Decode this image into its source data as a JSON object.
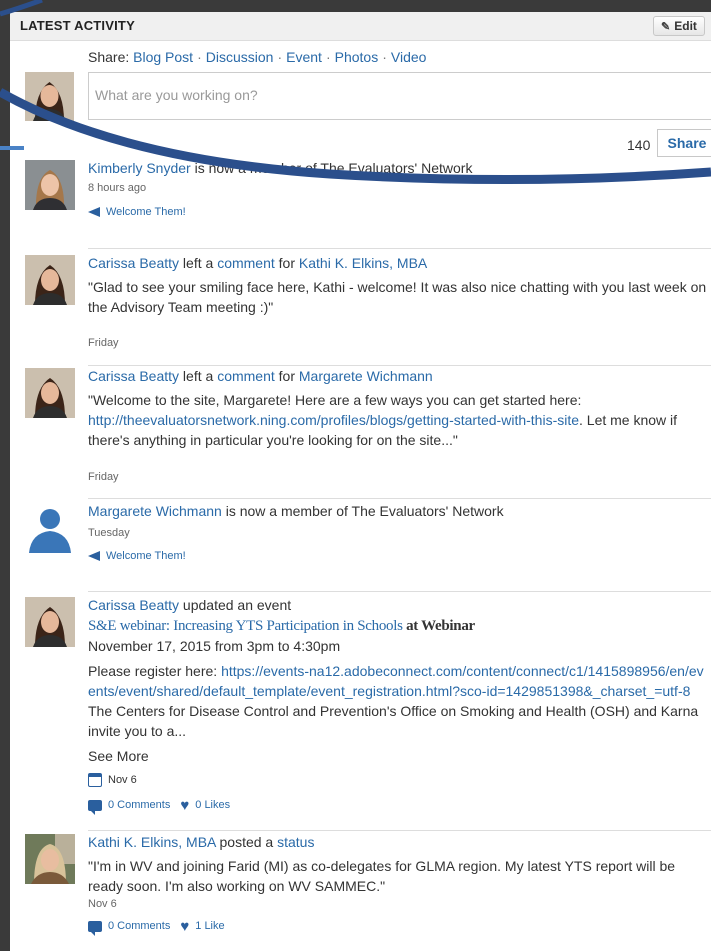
{
  "header": {
    "title": "LATEST ACTIVITY",
    "edit_label": "Edit"
  },
  "share": {
    "label": "Share:",
    "options": [
      "Blog Post",
      "Discussion",
      "Event",
      "Photos",
      "Video"
    ],
    "placeholder": "What are you working on?",
    "counter": "140",
    "button_label": "Share"
  },
  "feed": [
    {
      "name": "Kimberly Snyder",
      "text": " is now a member of The Evaluators' Network",
      "time": "8 hours ago",
      "action": "Welcome Them!"
    },
    {
      "name": "Carissa Beatty",
      "text1": " left a ",
      "link": "comment",
      "text2": " for ",
      "target": "Kathi K. Elkins, MBA",
      "quote": "\"Glad to see your smiling face here, Kathi - welcome! It was also nice chatting with you last week on the Advisory Team meeting :)\"",
      "time": "Friday"
    },
    {
      "name": "Carissa Beatty",
      "text1": " left a ",
      "link": "comment",
      "text2": " for ",
      "target": "Margarete Wichmann",
      "quote_start": "\"Welcome to the site, Margarete! Here are a few ways you can get started here: ",
      "quote_link": "http://theevaluatorsnetwork.ning.com/profiles/blogs/getting-started-with-this-site",
      "quote_end": ". Let me know if there's anything in particular you're looking for on the site...\"",
      "time": "Friday"
    },
    {
      "name": "Margarete Wichmann",
      "text": " is now a member of The Evaluators' Network",
      "time": "Tuesday",
      "action": "Welcome Them!"
    },
    {
      "name": "Carissa Beatty",
      "text": " updated an event",
      "event_title": "S&E webinar: Increasing YTS Participation in Schools",
      "event_at": " at Webinar",
      "event_time": "November 17, 2015 from 3pm to 4:30pm",
      "body_start": "Please register here: ",
      "body_link": "https://events-na12.adobeconnect.com/content/connect/c1/1415898956/en/events/event/shared/default_template/event_registration.html?sco-id=1429851398&_charset_=utf-8",
      "body_end": "The Centers for Disease Control and Prevention's Office on Smoking and Health (OSH) and Karna invite you to a...",
      "see_more": "See More",
      "date": "Nov 6",
      "comments": "0 Comments",
      "likes": "0 Likes"
    },
    {
      "name": "Kathi K. Elkins, MBA",
      "text1": " posted a ",
      "link": "status",
      "quote": "\"I'm in WV and joining Farid (MI) as co-delegates for GLMA region. My latest YTS report will be ready soon. I'm also working on WV SAMMEC.\"",
      "time": "Nov 6",
      "comments": "0 Comments",
      "likes": "1 Like"
    }
  ],
  "colors": {
    "link": "#2a6aa8",
    "icon": "#2a5f9e",
    "overlay_stroke": "#2b4f8c"
  }
}
